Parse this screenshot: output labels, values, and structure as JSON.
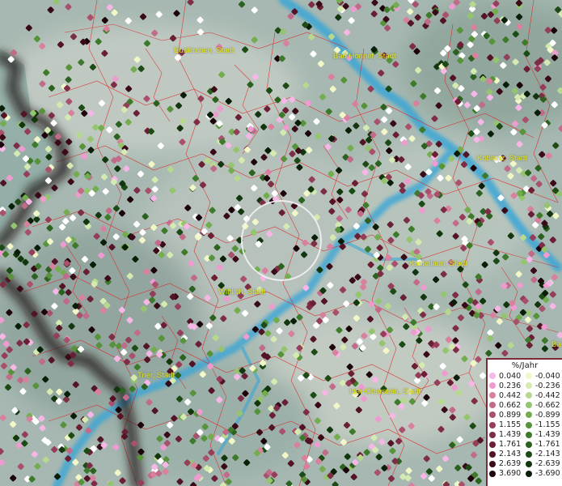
{
  "map": {
    "cities": [
      {
        "id": "euskirchen",
        "name": "Euskirchen, Stadt"
      },
      {
        "id": "bad-honnef",
        "name": "Bad Honnef, Stadt"
      },
      {
        "id": "koblenz",
        "name": "Koblenz, Stadt"
      },
      {
        "id": "kastellaun",
        "name": "Kastellaun, Stadt"
      },
      {
        "id": "wittlich",
        "name": "Wittlich, Stadt"
      },
      {
        "id": "trier",
        "name": "Trier, Stadt"
      },
      {
        "id": "idar-oberstein",
        "name": "Idar-Oberstein, Stadt"
      },
      {
        "id": "ba-partial",
        "name": "Ba"
      }
    ],
    "colors": {
      "water": "#3aa6d6",
      "border": "#dd2222",
      "country_border": "#2b1a1a",
      "label": "#e2e61a",
      "highlight_circle": "#f2f2f2"
    }
  },
  "legend": {
    "title": "%/Jahr",
    "positive": [
      {
        "value": "0.040",
        "color": "#f6b6e6"
      },
      {
        "value": "0.236",
        "color": "#ee9cd0"
      },
      {
        "value": "0.442",
        "color": "#d8809e"
      },
      {
        "value": "0.662",
        "color": "#c16a8a"
      },
      {
        "value": "0.899",
        "color": "#a8506c"
      },
      {
        "value": "1.155",
        "color": "#953e59"
      },
      {
        "value": "1.439",
        "color": "#7e2d46"
      },
      {
        "value": "1.761",
        "color": "#6a1f35"
      },
      {
        "value": "2.143",
        "color": "#531425"
      },
      {
        "value": "2.639",
        "color": "#3a0a17"
      },
      {
        "value": "3.690",
        "color": "#1c0209"
      }
    ],
    "negative": [
      {
        "value": "-0.040",
        "color": "#f2f7c8"
      },
      {
        "value": "-0.236",
        "color": "#d5eab0"
      },
      {
        "value": "-0.442",
        "color": "#b6d98d"
      },
      {
        "value": "-0.662",
        "color": "#95c46e"
      },
      {
        "value": "-0.899",
        "color": "#74ad4f"
      },
      {
        "value": "-1.155",
        "color": "#56933a"
      },
      {
        "value": "-1.439",
        "color": "#3e7a2b"
      },
      {
        "value": "-1.761",
        "color": "#2c6220"
      },
      {
        "value": "-2.143",
        "color": "#1d4b16"
      },
      {
        "value": "-2.639",
        "color": "#12360e"
      },
      {
        "value": "-3.690",
        "color": "#081e06"
      }
    ]
  }
}
